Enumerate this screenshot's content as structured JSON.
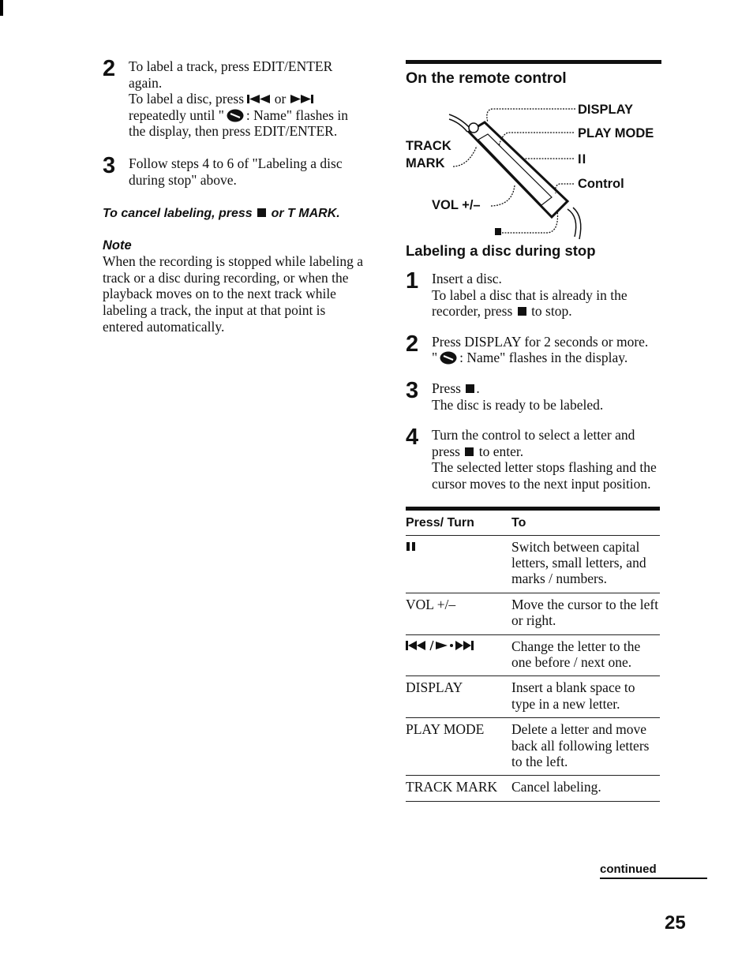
{
  "left_column": {
    "steps": [
      {
        "number": "2",
        "lines": [
          "To label a track, press EDIT/ENTER again.",
          "To label a disc, press",
          "or",
          "repeatedly until \"",
          ": Name\" flashes in the display, then press EDIT/ENTER."
        ]
      },
      {
        "number": "3",
        "text": "Follow steps 4 to 6 of \"Labeling a disc during stop\" above."
      }
    ],
    "cancel_heading_pre": "To cancel labeling, press",
    "cancel_heading_post": "or T MARK.",
    "note_title": "Note",
    "note_body": "When the recording is stopped while labeling a track or a disc during recording, or when the playback moves on to the next track while labeling a track, the input at that point is entered automatically."
  },
  "right_column": {
    "remote_heading": "On the remote control",
    "diagram_labels": {
      "display": "DISPLAY",
      "play_mode": "PLAY MODE",
      "pause": "II",
      "control": "Control",
      "track_mark_1": "TRACK",
      "track_mark_2": "MARK",
      "vol": "VOL +/–"
    },
    "labeling_heading": "Labeling a disc during stop",
    "steps": [
      {
        "number": "1",
        "a": "Insert a disc.",
        "b": "To label a disc that is already in the recorder, press",
        "c": "to stop."
      },
      {
        "number": "2",
        "a": "Press DISPLAY for 2 seconds or more.",
        "b": "\"",
        "c": ": Name\" flashes in the display."
      },
      {
        "number": "3",
        "a": "Press",
        "b": ".",
        "c": "The disc is ready to be labeled."
      },
      {
        "number": "4",
        "a": "Turn the control to select a letter and press",
        "b": "to enter.",
        "c": "The selected letter stops flashing and the cursor moves to the next input position."
      }
    ],
    "table": {
      "headers": [
        "Press/ Turn",
        "To"
      ],
      "rows": [
        {
          "key": "II",
          "action": "Switch between capital letters, small letters, and marks / numbers."
        },
        {
          "key": "VOL +/–",
          "action": "Move the cursor to the left or right."
        },
        {
          "key": "◄◄ / ► • ►►",
          "action": "Change the letter to the one before / next one."
        },
        {
          "key": "DISPLAY",
          "action": "Insert a blank space to type in a new letter."
        },
        {
          "key": "PLAY MODE",
          "action": "Delete a letter and move back all following letters to the left."
        },
        {
          "key": "TRACK MARK",
          "action": "Cancel labeling."
        }
      ]
    }
  },
  "footer": {
    "continued": "continued",
    "page_number": "25"
  }
}
